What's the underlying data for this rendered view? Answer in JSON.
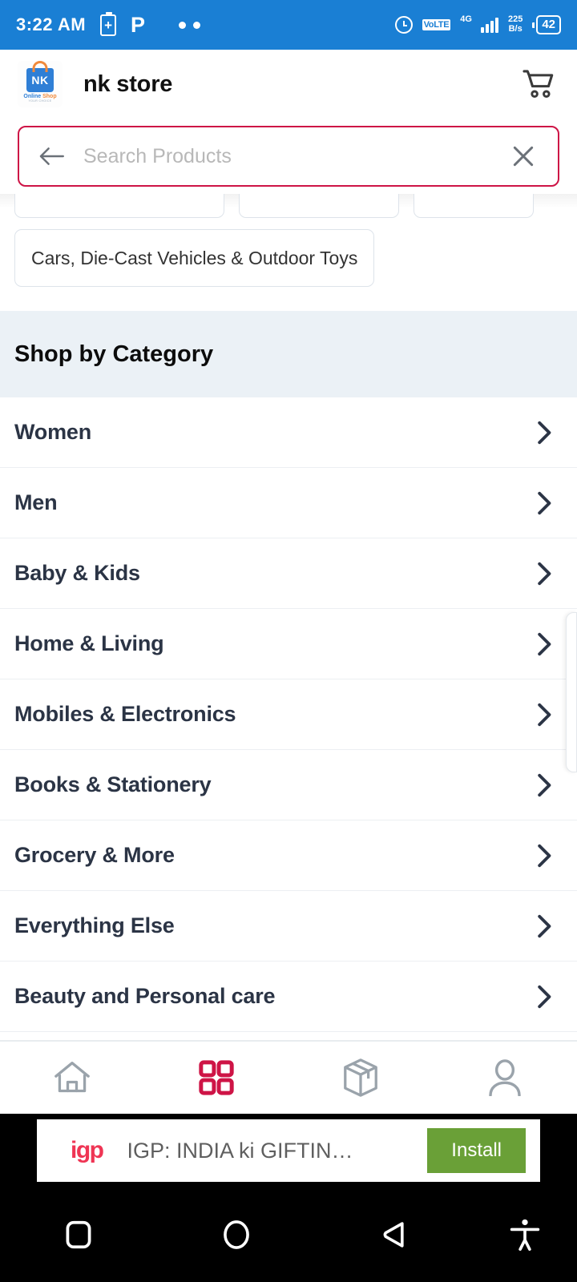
{
  "status_bar": {
    "time": "3:22 AM",
    "battery_plus_icon": "battery-plus-icon",
    "p_icon": "P",
    "dots_icon": "more-dots-icon",
    "alarm_icon": "alarm-icon",
    "volte_label": "VoLTE",
    "network_type": "4G",
    "net_speed_value": "225",
    "net_speed_unit": "B/s",
    "battery_percent": "42",
    "background_color": "#1a7fd4"
  },
  "app_bar": {
    "logo_name": "NK",
    "logo_sub_first": "Online",
    "logo_sub_second": "Shop",
    "logo_tagline": "YOUR CHOICE",
    "title": "nk store",
    "cart_icon": "shopping-cart-icon"
  },
  "search": {
    "placeholder": "Search Products",
    "value": "",
    "back_icon": "arrow-left-icon",
    "clear_icon": "close-icon",
    "border_color": "#ce1446"
  },
  "chips": {
    "partial_row": [
      "",
      "",
      ""
    ],
    "visible": [
      "Cars, Die-Cast Vehicles & Outdoor Toys"
    ]
  },
  "section": {
    "title": "Shop by Category",
    "background_color": "#ebf1f6"
  },
  "categories": [
    {
      "label": "Women",
      "chevron": "chevron-right-icon"
    },
    {
      "label": "Men",
      "chevron": "chevron-right-icon"
    },
    {
      "label": "Baby & Kids",
      "chevron": "chevron-right-icon"
    },
    {
      "label": "Home & Living",
      "chevron": "chevron-right-icon"
    },
    {
      "label": "Mobiles & Electronics",
      "chevron": "chevron-right-icon"
    },
    {
      "label": "Books & Stationery",
      "chevron": "chevron-right-icon"
    },
    {
      "label": "Grocery & More",
      "chevron": "chevron-right-icon"
    },
    {
      "label": "Everything Else",
      "chevron": "chevron-right-icon"
    },
    {
      "label": "Beauty and Personal care",
      "chevron": "chevron-right-icon"
    }
  ],
  "bottom_nav": {
    "active_color": "#ce1446",
    "inactive_color": "#9aa3ab",
    "items": [
      {
        "icon": "home-icon",
        "active": false
      },
      {
        "icon": "grid-categories-icon",
        "active": true
      },
      {
        "icon": "package-orders-icon",
        "active": false
      },
      {
        "icon": "account-person-icon",
        "active": false
      }
    ]
  },
  "ad": {
    "logo_text": "igp",
    "title": "IGP: INDIA ki GIFTIN…",
    "install_label": "Install",
    "install_color": "#6aa037"
  },
  "android_nav": {
    "recents_icon": "square-recents-icon",
    "home_icon": "circle-home-icon",
    "back_icon": "triangle-back-icon",
    "accessibility_icon": "accessibility-icon"
  }
}
